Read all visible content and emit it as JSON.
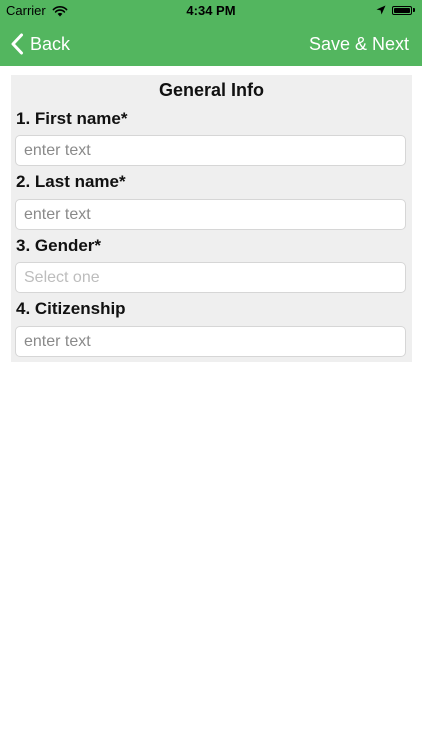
{
  "status_bar": {
    "carrier": "Carrier",
    "time": "4:34 PM",
    "icons": [
      "wifi-icon",
      "location-arrow-icon",
      "battery-icon"
    ]
  },
  "nav": {
    "back_label": "Back",
    "back_icon": "chevron-left-icon",
    "save_next_label": "Save & Next",
    "background_color": "#53b65f"
  },
  "form": {
    "title": "General Info",
    "fields": [
      {
        "label": "1. First name*",
        "type": "text",
        "placeholder": "enter text",
        "value": ""
      },
      {
        "label": "2. Last name*",
        "type": "text",
        "placeholder": "enter text",
        "value": ""
      },
      {
        "label": "3. Gender*",
        "type": "select",
        "placeholder": "Select one",
        "value": ""
      },
      {
        "label": "4. Citizenship",
        "type": "text",
        "placeholder": "enter text",
        "value": ""
      }
    ]
  }
}
